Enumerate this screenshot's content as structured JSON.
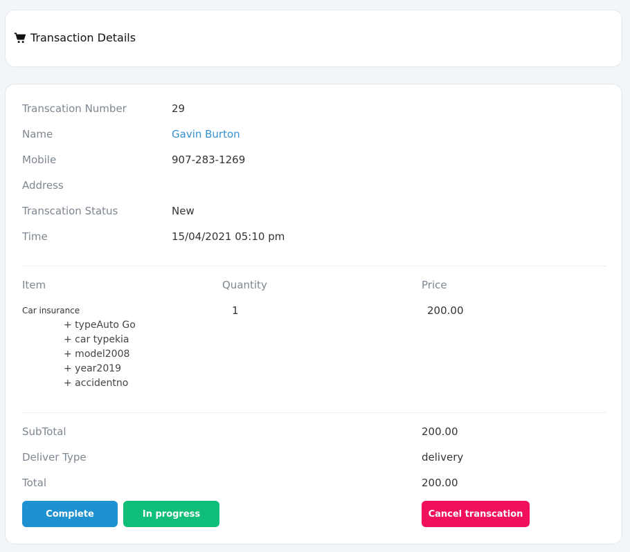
{
  "header": {
    "icon": "shopping-cart-icon",
    "title": "Transaction Details"
  },
  "details": {
    "transaction_number_label": "Transcation Number",
    "transaction_number": "29",
    "name_label": "Name",
    "name": "Gavin Burton",
    "mobile_label": "Mobile",
    "mobile": "907-283-1269",
    "address_label": "Address",
    "address": "",
    "status_label": "Transcation Status",
    "status": "New",
    "time_label": "Time",
    "time": "15/04/2021 05:10 pm"
  },
  "items": {
    "headers": [
      "Item",
      "Quantity",
      "Price"
    ],
    "rows": [
      {
        "name": "Car insurance",
        "options": [
          "+ typeAuto Go",
          "+ car typekia",
          "+ model2008",
          "+ year2019",
          "+ accidentno"
        ],
        "quantity": "1",
        "price": "200.00"
      }
    ]
  },
  "totals": {
    "subtotal_label": "SubTotal",
    "subtotal": "200.00",
    "deliver_type_label": "Deliver Type",
    "deliver_type": "delivery",
    "total_label": "Total",
    "total": "200.00"
  },
  "actions": {
    "complete": "Complete",
    "in_progress": "In progress",
    "cancel": "Cancel transcation"
  },
  "colors": {
    "link": "#3391d0",
    "complete": "#1e91d0",
    "in_progress": "#0fbf79",
    "cancel": "#f0115a"
  }
}
